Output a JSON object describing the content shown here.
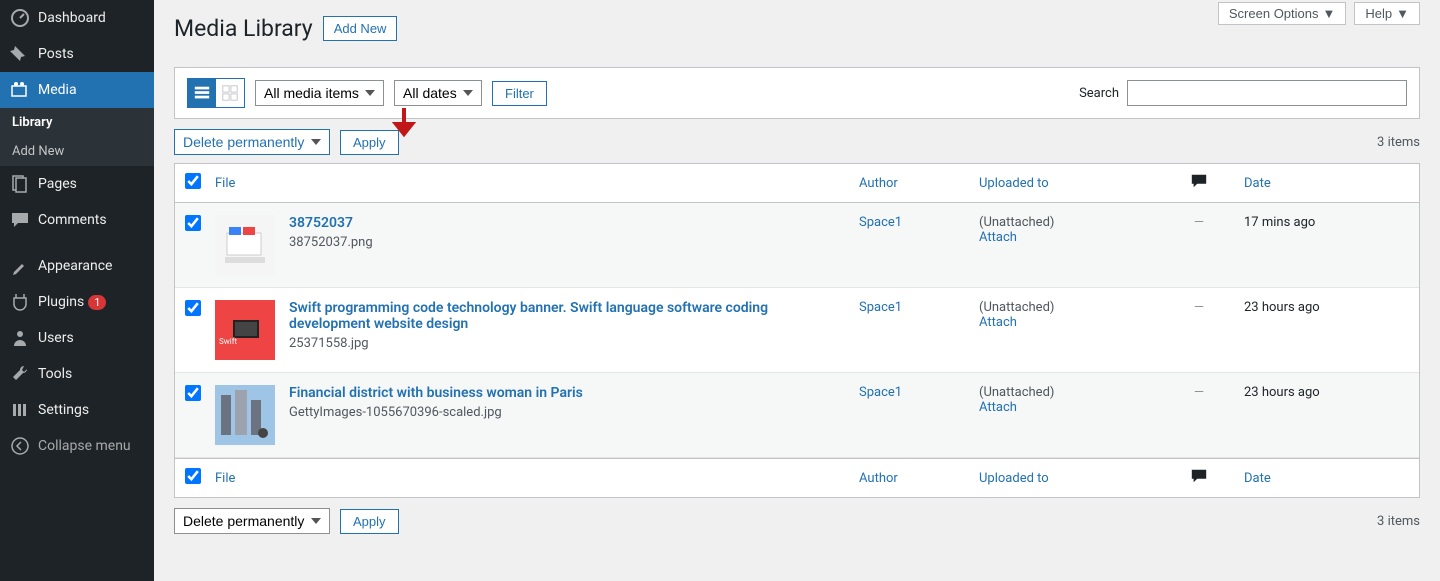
{
  "topbar": {
    "screen_options": "Screen Options",
    "help": "Help"
  },
  "sidebar": {
    "items": [
      {
        "label": "Dashboard",
        "icon": "dashboard"
      },
      {
        "label": "Posts",
        "icon": "pin"
      },
      {
        "label": "Media",
        "icon": "media",
        "current": true
      },
      {
        "label": "Pages",
        "icon": "page"
      },
      {
        "label": "Comments",
        "icon": "comment"
      },
      {
        "label": "Appearance",
        "icon": "brush"
      },
      {
        "label": "Plugins",
        "icon": "plug",
        "badge": "1"
      },
      {
        "label": "Users",
        "icon": "user"
      },
      {
        "label": "Tools",
        "icon": "wrench"
      },
      {
        "label": "Settings",
        "icon": "settings"
      },
      {
        "label": "Collapse menu",
        "icon": "collapse"
      }
    ],
    "subitems": [
      {
        "label": "Library",
        "active": true
      },
      {
        "label": "Add New"
      }
    ]
  },
  "header": {
    "title": "Media Library",
    "add_new": "Add New"
  },
  "filters": {
    "media_items": "All media items",
    "dates": "All dates",
    "filter_btn": "Filter",
    "search_label": "Search",
    "search_placeholder": ""
  },
  "bulk": {
    "action": "Delete permanently",
    "apply": "Apply",
    "items_count": "3 items"
  },
  "columns": {
    "file": "File",
    "author": "Author",
    "uploaded": "Uploaded to",
    "date": "Date"
  },
  "rows": [
    {
      "title": "38752037",
      "filename": "38752037.png",
      "author": "Space1",
      "uploaded_status": "(Unattached)",
      "attach": "Attach",
      "comments": "—",
      "date": "17 mins ago",
      "thumb_type": "laptop"
    },
    {
      "title": "Swift programming code technology banner. Swift language software coding development website design",
      "filename": "25371558.jpg",
      "author": "Space1",
      "uploaded_status": "(Unattached)",
      "attach": "Attach",
      "comments": "—",
      "date": "23 hours ago",
      "thumb_type": "swift"
    },
    {
      "title": "Financial district with business woman in Paris",
      "filename": "GettyImages-1055670396-scaled.jpg",
      "author": "Space1",
      "uploaded_status": "(Unattached)",
      "attach": "Attach",
      "comments": "—",
      "date": "23 hours ago",
      "thumb_type": "city"
    }
  ]
}
